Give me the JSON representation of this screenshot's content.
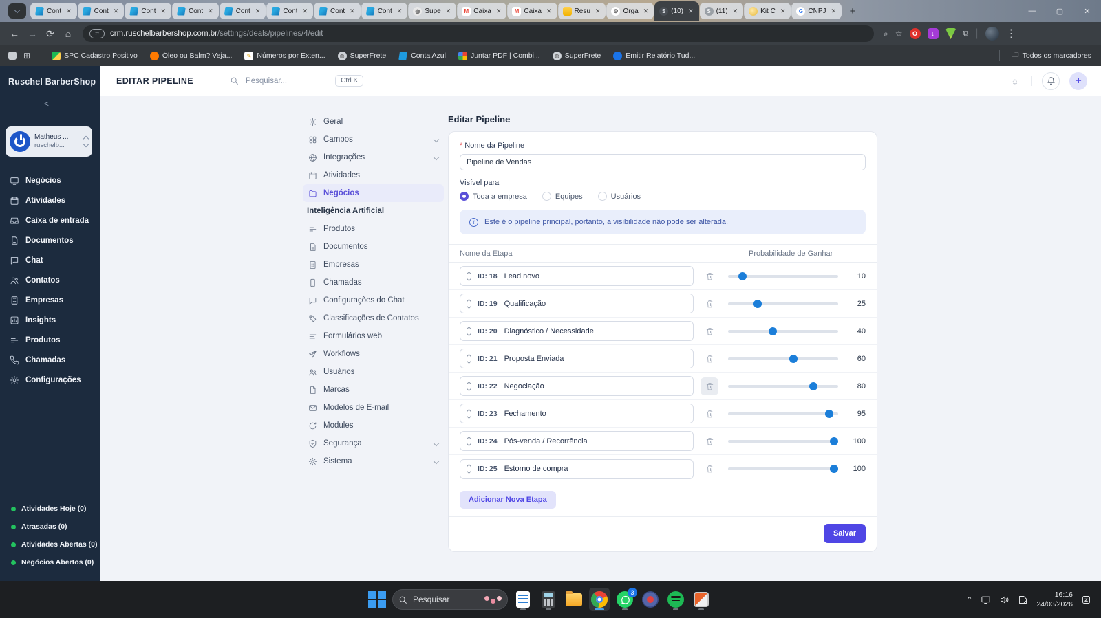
{
  "browser": {
    "tabs": [
      {
        "title": "Cont",
        "icon": "conta-azul"
      },
      {
        "title": "Cont",
        "icon": "conta-azul"
      },
      {
        "title": "Cont",
        "icon": "conta-azul"
      },
      {
        "title": "Cont",
        "icon": "conta-azul"
      },
      {
        "title": "Cont",
        "icon": "conta-azul"
      },
      {
        "title": "Cont",
        "icon": "conta-azul"
      },
      {
        "title": "Cont",
        "icon": "conta-azul"
      },
      {
        "title": "Cont",
        "icon": "conta-azul"
      },
      {
        "title": "Supe",
        "icon": "globe"
      },
      {
        "title": "Caixa",
        "icon": "gmail"
      },
      {
        "title": "Caixa",
        "icon": "gmail"
      },
      {
        "title": "Resu",
        "icon": "yellow"
      },
      {
        "title": "Orga",
        "icon": "gear"
      },
      {
        "title": "(10)",
        "icon": "swirl",
        "active": true
      },
      {
        "title": "(11)",
        "icon": "swirl"
      },
      {
        "title": "Kit C",
        "icon": "kit"
      },
      {
        "title": "CNPJ",
        "icon": "google"
      }
    ],
    "url_host": "crm.ruschelbarbershop.com.br",
    "url_path": "/settings/deals/pipelines/4/edit",
    "gmail_m": "M",
    "google_g": "G",
    "bookmarks": [
      "SPC Cadastro Positivo",
      "Óleo ou Balm? Veja...",
      "Números por Exten...",
      "SuperFrete",
      "Conta Azul",
      "Juntar PDF | Combi...",
      "SuperFrete",
      "Emitir Relatório Tud..."
    ],
    "all_bookmarks": "Todos os marcadores"
  },
  "sidebar": {
    "brand": "Ruschel BarberShop",
    "user": {
      "name": "Matheus ...",
      "org": "ruschelb..."
    },
    "items": [
      {
        "label": "Negócios",
        "icon": "monitor"
      },
      {
        "label": "Atividades",
        "icon": "calendar"
      },
      {
        "label": "Caixa de entrada",
        "icon": "inbox"
      },
      {
        "label": "Documentos",
        "icon": "file"
      },
      {
        "label": "Chat",
        "icon": "chat"
      },
      {
        "label": "Contatos",
        "icon": "users"
      },
      {
        "label": "Empresas",
        "icon": "building"
      },
      {
        "label": "Insights",
        "icon": "bar-chart"
      },
      {
        "label": "Produtos",
        "icon": "list"
      },
      {
        "label": "Chamadas",
        "icon": "phone"
      },
      {
        "label": "Configurações",
        "icon": "gear"
      }
    ],
    "footer_items": [
      {
        "label": "Atividades Hoje (0)"
      },
      {
        "label": "Atrasadas (0)"
      },
      {
        "label": "Atividades Abertas (0)"
      },
      {
        "label": "Negócios Abertos (0)"
      }
    ]
  },
  "header": {
    "title": "EDITAR PIPELINE",
    "search_placeholder": "Pesquisar...",
    "shortcut": "Ctrl K"
  },
  "settings_nav": {
    "items": [
      {
        "label": "Geral",
        "icon": "gear"
      },
      {
        "label": "Campos",
        "icon": "grid",
        "chevron": true
      },
      {
        "label": "Integrações",
        "icon": "globe",
        "chevron": true
      },
      {
        "label": "Atividades",
        "icon": "calendar"
      },
      {
        "label": "Negócios",
        "icon": "folder",
        "active": true
      },
      {
        "label": "Inteligência Artificial",
        "section": true
      },
      {
        "label": "Produtos",
        "icon": "list"
      },
      {
        "label": "Documentos",
        "icon": "file"
      },
      {
        "label": "Empresas",
        "icon": "building"
      },
      {
        "label": "Chamadas",
        "icon": "mobile"
      },
      {
        "label": "Configurações do Chat",
        "icon": "chat"
      },
      {
        "label": "Classificações de Contatos",
        "icon": "tag"
      },
      {
        "label": "Formulários web",
        "icon": "list"
      },
      {
        "label": "Workflows",
        "icon": "plane"
      },
      {
        "label": "Usuários",
        "icon": "users"
      },
      {
        "label": "Marcas",
        "icon": "file"
      },
      {
        "label": "Modelos de E-mail",
        "icon": "mail"
      },
      {
        "label": "Modules",
        "icon": "refresh"
      },
      {
        "label": "Segurança",
        "icon": "shield",
        "chevron": true
      },
      {
        "label": "Sistema",
        "icon": "gear",
        "chevron": true
      }
    ]
  },
  "main": {
    "page_title": "Editar Pipeline",
    "required_mark": "*",
    "name_label": "Nome da Pipeline",
    "name_value": "Pipeline de Vendas",
    "visibility_label": "Visível para",
    "visibility_options": [
      "Toda a empresa",
      "Equipes",
      "Usuários"
    ],
    "alert_icon": "i",
    "alert": "Este é o pipeline principal, portanto, a visibilidade não pode ser alterada.",
    "col_stage": "Nome da Etapa",
    "col_prob": "Probabilidade de Ganhar",
    "stages": [
      {
        "id_label": "ID: 18",
        "name": "Lead novo",
        "prob": 10
      },
      {
        "id_label": "ID: 19",
        "name": "Qualificação",
        "prob": 25
      },
      {
        "id_label": "ID: 20",
        "name": "Diagnóstico / Necessidade",
        "prob": 40
      },
      {
        "id_label": "ID: 21",
        "name": "Proposta Enviada",
        "prob": 60
      },
      {
        "id_label": "ID: 22",
        "name": "Negociação",
        "prob": 80
      },
      {
        "id_label": "ID: 23",
        "name": "Fechamento",
        "prob": 95
      },
      {
        "id_label": "ID: 24",
        "name": "Pós-venda / Recorrência",
        "prob": 100
      },
      {
        "id_label": "ID: 25",
        "name": "Estorno de compra",
        "prob": 100
      }
    ],
    "add_button": "Adicionar Nova Etapa",
    "save_button": "Salvar"
  },
  "taskbar": {
    "search": "Pesquisar",
    "whatsapp_badge": "3",
    "time": "16:16",
    "date": "24/03/2026"
  },
  "colors": {
    "accent": "#4f46e5",
    "slider_handle": "#1b7ed9",
    "sidebar_bg": "#1c2b3e",
    "status_green": "#23c25f",
    "alert_bg": "#e9eefb"
  }
}
